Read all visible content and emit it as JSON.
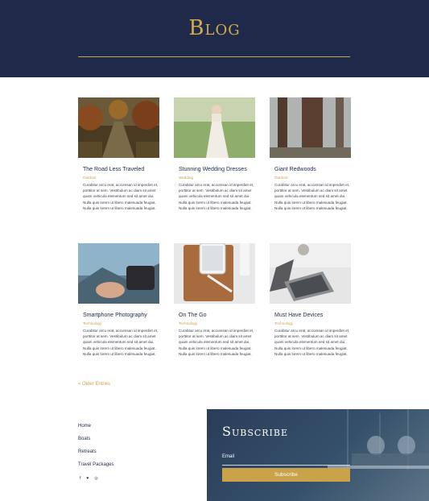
{
  "header": {
    "title": "Blog"
  },
  "posts": [
    {
      "title": "The Road Less Traveled",
      "category": "Outdoor",
      "excerpt": "Curabitur arcu erat, accumsan id imperdiet et, porttitor at sem. Vestibulum ac diam sit amet quam vehicula elementum sed sit amet dui. Nulla quis lorem ut libero malesuada feugiat. Nulla quis lorem ut libero malesuada feugiat."
    },
    {
      "title": "Stunning Wedding Dresses",
      "category": "Wedding",
      "excerpt": "Curabitur arcu erat, accumsan id imperdiet et, porttitor at sem. Vestibulum ac diam sit amet quam vehicula elementum sed sit amet dui. Nulla quis lorem ut libero malesuada feugiat. Nulla quis lorem ut libero malesuada feugiat."
    },
    {
      "title": "Giant Redwoods",
      "category": "Outdoor",
      "excerpt": "Curabitur arcu erat, accumsan id imperdiet et, porttitor at sem. Vestibulum ac diam sit amet quam vehicula elementum sed sit amet dui. Nulla quis lorem ut libero malesuada feugiat. Nulla quis lorem ut libero malesuada feugiat."
    },
    {
      "title": "Smartphone Photography",
      "category": "Technology",
      "excerpt": "Curabitur arcu erat, accumsan id imperdiet et, porttitor at sem. Vestibulum ac diam sit amet quam vehicula elementum sed sit amet dui. Nulla quis lorem ut libero malesuada feugiat. Nulla quis lorem ut libero malesuada feugiat."
    },
    {
      "title": "On The Go",
      "category": "Technology",
      "excerpt": "Curabitur arcu erat, accumsan id imperdiet et, porttitor at sem. Vestibulum ac diam sit amet quam vehicula elementum sed sit amet dui. Nulla quis lorem ut libero malesuada feugiat. Nulla quis lorem ut libero malesuada feugiat."
    },
    {
      "title": "Must Have Devices",
      "category": "Technology",
      "excerpt": "Curabitur arcu erat, accumsan id imperdiet et, porttitor at sem. Vestibulum ac diam sit amet quam vehicula elementum sed sit amet dui. Nulla quis lorem ut libero malesuada feugiat. Nulla quis lorem ut libero malesuada feugiat."
    }
  ],
  "pagination": {
    "older_label": "« Older Entries"
  },
  "footer": {
    "links": [
      "Home",
      "Boats",
      "Retreats",
      "Travel Packages"
    ],
    "social": [
      "f",
      "♥",
      "◎"
    ]
  },
  "subscribe": {
    "title": "Subscribe",
    "email_label": "Email",
    "button": "Subscribe"
  },
  "colors": {
    "navy": "#1f2a4a",
    "gold": "#c9a24a"
  }
}
